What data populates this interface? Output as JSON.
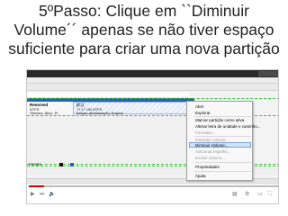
{
  "slide": {
    "title_line1": "5ºPasso: Clique em ``Diminuir",
    "title_line2": "Volume´´ apenas se não tiver espaço",
    "title_line3": "suficiente para criar uma nova partição"
  },
  "disk_management": {
    "reserved_partition": {
      "name": "Reserved",
      "line1": "NTFS",
      "line2": "Sistema, Ativo, Pr"
    },
    "c_partition": {
      "name": "(C:)",
      "line1": "77,17 GB NTFS",
      "line2": "Íntegro (Inicialização, Arquivo"
    },
    "legend_label": "rimaria",
    "progress_fraction": 0.06
  },
  "context_menu": {
    "items": [
      {
        "label": "Abrir",
        "enabled": true
      },
      {
        "label": "Explorar",
        "enabled": true
      },
      {
        "label": "Marcar partição como ativa",
        "enabled": true
      },
      {
        "label": "Alterar letra de unidade e caminho...",
        "enabled": true
      },
      {
        "label": "Formatar...",
        "enabled": false
      },
      {
        "label": "Estender volume...",
        "enabled": false
      },
      {
        "label": "Diminuir Volume...",
        "enabled": true,
        "highlighted": true
      },
      {
        "label": "Adicionar espelho...",
        "enabled": false
      },
      {
        "label": "Excluir volume...",
        "enabled": false
      },
      {
        "label": "Propriedades",
        "enabled": true
      },
      {
        "label": "Ajuda",
        "enabled": true
      }
    ]
  },
  "player": {
    "play_icon": "play-icon",
    "next_icon": "next-icon",
    "volume_icon": "volume-icon",
    "settings_icon": "gear-icon",
    "fullscreen_icon": "fullscreen-icon"
  },
  "colors": {
    "partition_header": "#2e5fb8",
    "selection_border": "#32c832",
    "progress": "#d40000",
    "menu_highlight": "#cfe3fb"
  }
}
